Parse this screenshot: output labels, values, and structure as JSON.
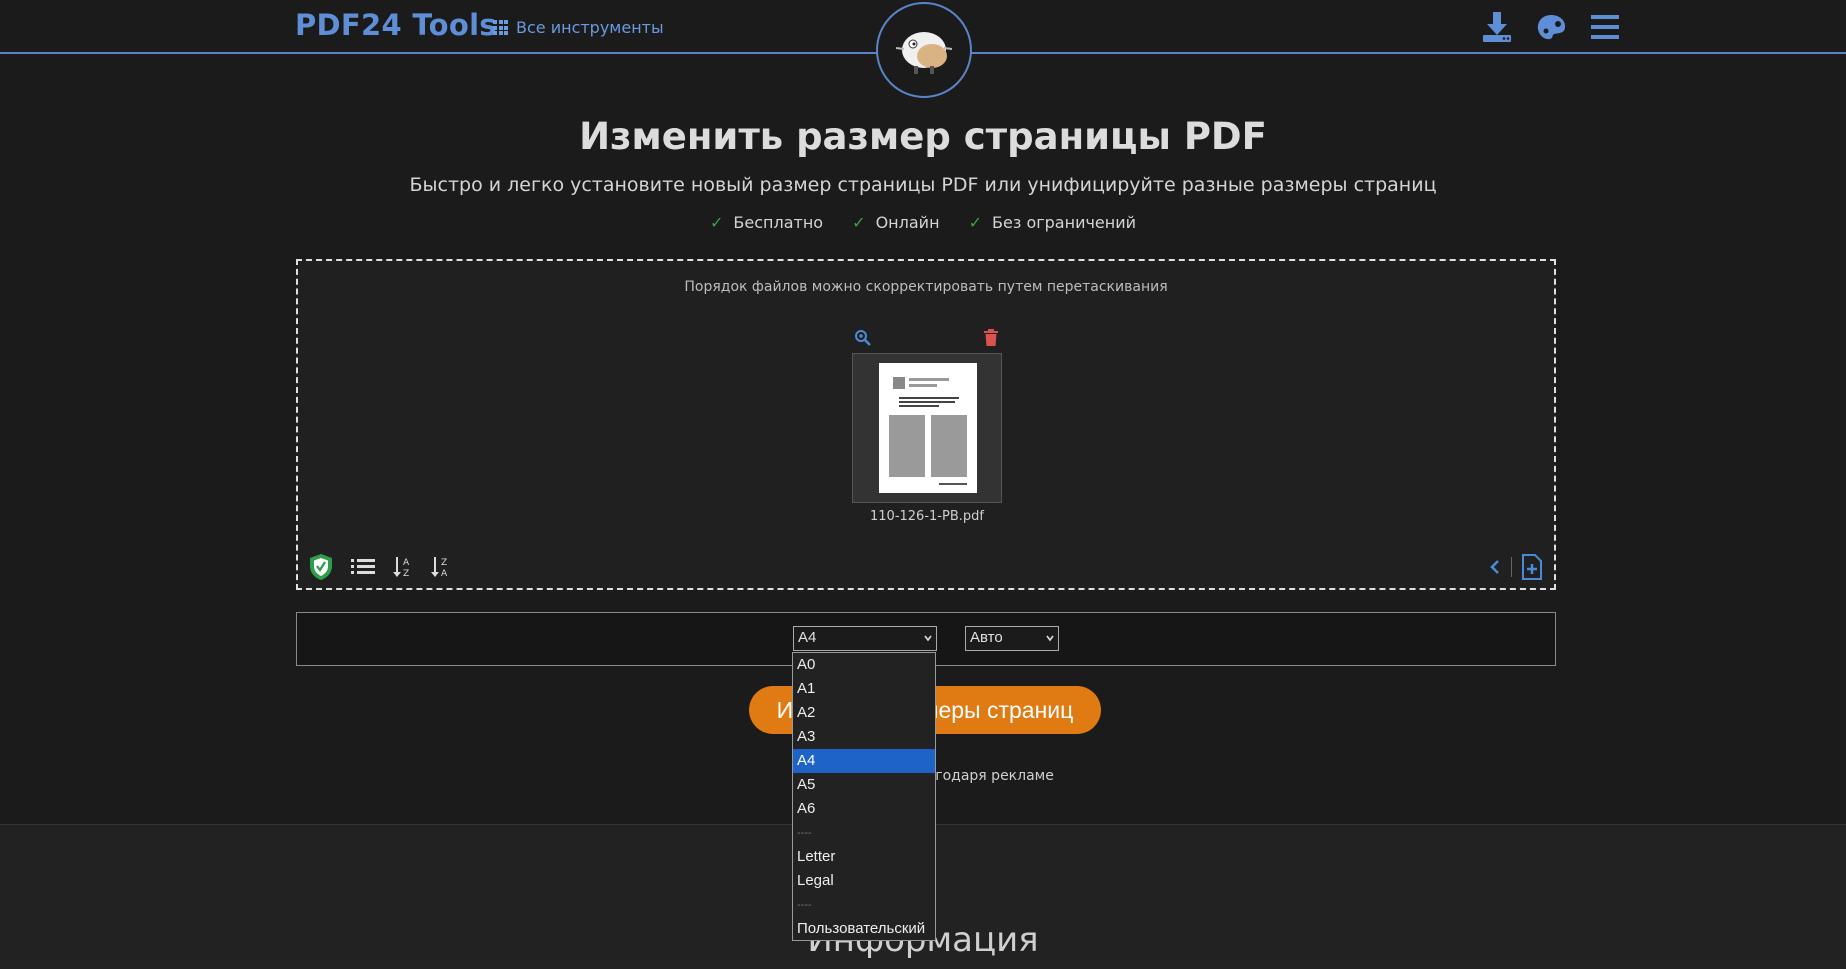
{
  "header": {
    "logo": "PDF24 Tools",
    "all_tools": "Все инструменты"
  },
  "hero": {
    "title": "Изменить размер страницы PDF",
    "subtitle": "Быстро и легко установите новый размер страницы PDF или унифицируйте разные размеры страниц",
    "features": [
      "Бесплатно",
      "Онлайн",
      "Без ограничений"
    ]
  },
  "dropzone": {
    "hint": "Порядок файлов можно скорректировать путем перетаскивания",
    "file_name": "110-126-1-PB.pdf"
  },
  "options": {
    "page_size_value": "A4",
    "orientation_value": "Авто"
  },
  "dropdown": {
    "options": [
      "A0",
      "A1",
      "A2",
      "A3",
      "A4",
      "A5",
      "A6",
      "----",
      "Letter",
      "Legal",
      "----",
      "Пользовательский"
    ],
    "selected": "A4"
  },
  "action": {
    "button_label": "Изменить размеры страниц",
    "ad_note": "Бесплатно благодаря рекламе"
  },
  "info": {
    "heading": "Информация"
  },
  "colors": {
    "accent": "#5e8ed6",
    "button": "#e07a12",
    "check": "#3aa14b",
    "highlight": "#1e63c7",
    "delete": "#d9534f"
  }
}
